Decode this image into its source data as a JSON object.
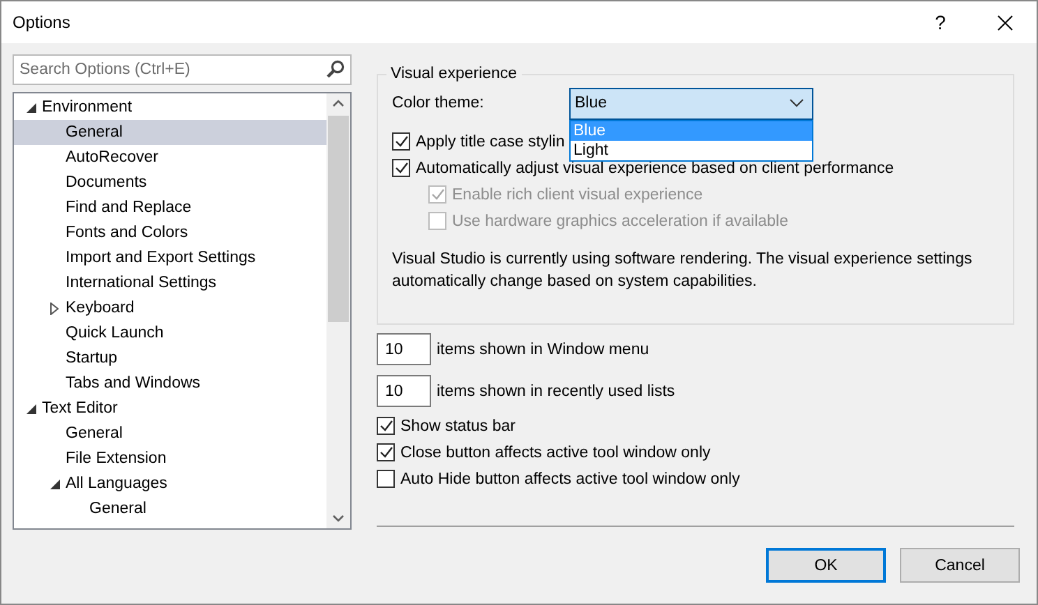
{
  "window": {
    "title": "Options",
    "help": "?"
  },
  "search": {
    "placeholder": "Search Options (Ctrl+E)"
  },
  "tree": [
    {
      "label": "Environment",
      "expanded": true,
      "children": [
        {
          "label": "General",
          "selected": true
        },
        {
          "label": "AutoRecover",
          "selected": false
        },
        {
          "label": "Documents",
          "selected": false
        },
        {
          "label": "Find and Replace",
          "selected": false
        },
        {
          "label": "Fonts and Colors",
          "selected": false
        },
        {
          "label": "Import and Export Settings",
          "selected": false
        },
        {
          "label": "International Settings",
          "selected": false
        },
        {
          "label": "Keyboard",
          "selected": false,
          "expanded": false
        },
        {
          "label": "Quick Launch",
          "selected": false
        },
        {
          "label": "Startup",
          "selected": false
        },
        {
          "label": "Tabs and Windows",
          "selected": false
        }
      ]
    },
    {
      "label": "Text Editor",
      "expanded": true,
      "children": [
        {
          "label": "General",
          "selected": false
        },
        {
          "label": "File Extension",
          "selected": false
        },
        {
          "label": "All Languages",
          "selected": false,
          "expanded": true,
          "children": [
            {
              "label": "General",
              "selected": false
            }
          ]
        }
      ]
    }
  ],
  "visual_experience": {
    "title": "Visual experience",
    "color_theme": {
      "label": "Color theme:",
      "value": "Blue",
      "open": true,
      "options": [
        {
          "label": "Blue",
          "selected": true
        },
        {
          "label": "Light",
          "selected": false
        }
      ]
    },
    "options": [
      {
        "label": "Apply title case stylin",
        "checked": true,
        "disabled": false,
        "indented": false
      },
      {
        "label": "Automatically adjust visual experience based on client performance",
        "checked": true,
        "disabled": false,
        "indented": false
      },
      {
        "label": "Enable rich client visual experience",
        "checked": true,
        "disabled": true,
        "indented": true
      },
      {
        "label": "Use hardware graphics acceleration if available",
        "checked": false,
        "disabled": true,
        "indented": true
      }
    ],
    "note": "Visual Studio is currently using software rendering.  The visual experience settings automatically change based on system capabilities."
  },
  "counts": [
    {
      "value": "10",
      "label": "items shown in Window menu"
    },
    {
      "value": "10",
      "label": "items shown in recently used lists"
    }
  ],
  "checkboxes": [
    {
      "label": "Show status bar",
      "checked": true
    },
    {
      "label": "Close button affects active tool window only",
      "checked": true
    },
    {
      "label": "Auto Hide button affects active tool window only",
      "checked": false
    }
  ],
  "buttons": [
    {
      "label": "OK",
      "default": true
    },
    {
      "label": "Cancel",
      "default": false
    }
  ]
}
